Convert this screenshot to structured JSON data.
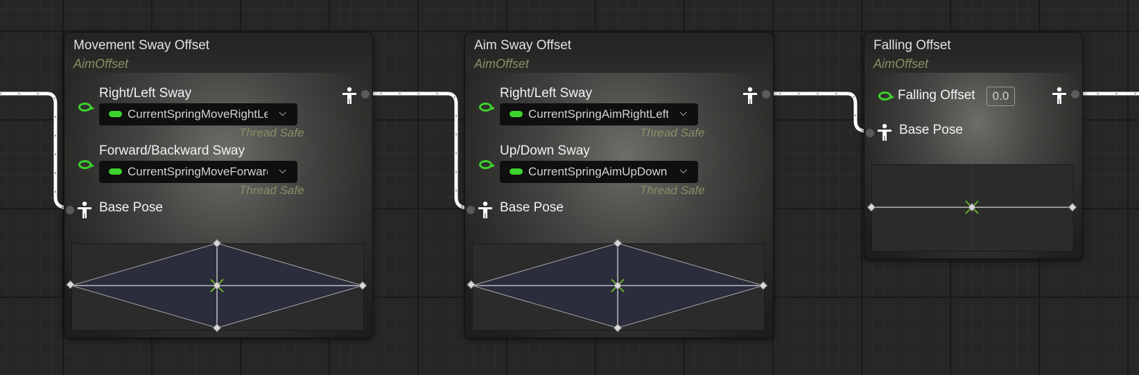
{
  "nodes": [
    {
      "title": "Movement Sway Offset",
      "subtitle": "AimOffset",
      "inputs": [
        {
          "label": "Right/Left Sway",
          "variable": "CurrentSpringMoveRightLeft",
          "note": "Thread Safe"
        },
        {
          "label": "Forward/Backward Sway",
          "variable": "CurrentSpringMoveForwardBackward",
          "note": "Thread Safe"
        }
      ],
      "base_pose_label": "Base Pose"
    },
    {
      "title": "Aim Sway Offset",
      "subtitle": "AimOffset",
      "inputs": [
        {
          "label": "Right/Left Sway",
          "variable": "CurrentSpringAimRightLeft",
          "note": "Thread Safe"
        },
        {
          "label": "Up/Down Sway",
          "variable": "CurrentSpringAimUpDown",
          "note": "Thread Safe"
        }
      ],
      "base_pose_label": "Base Pose"
    },
    {
      "title": "Falling Offset",
      "subtitle": "AimOffset",
      "inputs": [
        {
          "label": "Falling Offset",
          "value": "0.0"
        }
      ],
      "base_pose_label": "Base Pose"
    }
  ],
  "colors": {
    "float_pin": "#3cd32c",
    "subtitle": "#8b8f66",
    "wire": "#ffffff",
    "preview_fill": "#2b2c3c"
  },
  "icons": {
    "pose_pin": "person-pose-icon",
    "float_pin": "float-pin-icon"
  }
}
